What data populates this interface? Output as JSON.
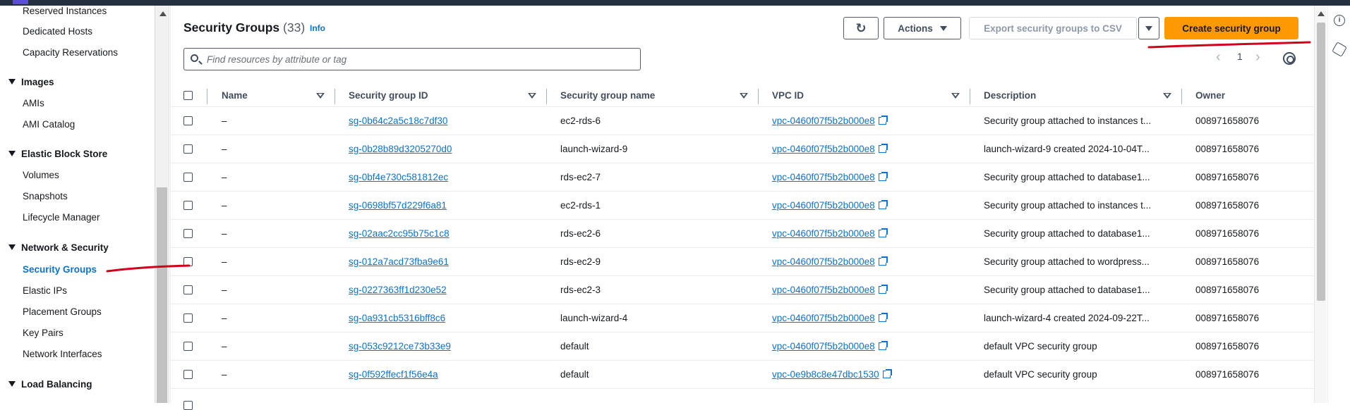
{
  "sidebar": {
    "items_top": [
      {
        "label": "Reserved Instances"
      },
      {
        "label": "Dedicated Hosts"
      },
      {
        "label": "Capacity Reservations"
      }
    ],
    "sections": [
      {
        "title": "Images",
        "items": [
          "AMIs",
          "AMI Catalog"
        ]
      },
      {
        "title": "Elastic Block Store",
        "items": [
          "Volumes",
          "Snapshots",
          "Lifecycle Manager"
        ]
      },
      {
        "title": "Network & Security",
        "items": [
          "Security Groups",
          "Elastic IPs",
          "Placement Groups",
          "Key Pairs",
          "Network Interfaces"
        ]
      },
      {
        "title": "Load Balancing",
        "items": []
      }
    ],
    "active_item": "Security Groups"
  },
  "header": {
    "title": "Security Groups",
    "count": "(33)",
    "info": "Info"
  },
  "toolbar": {
    "refresh_icon": "refresh-icon",
    "actions_label": "Actions",
    "export_label": "Export security groups to CSV",
    "create_label": "Create security group"
  },
  "search": {
    "placeholder": "Find resources by attribute or tag"
  },
  "pagination": {
    "current_page": "1"
  },
  "table": {
    "columns": [
      "Name",
      "Security group ID",
      "Security group name",
      "VPC ID",
      "Description",
      "Owner"
    ],
    "rows": [
      {
        "name": "–",
        "sg_id": "sg-0b64c2a5c18c7df30",
        "sg_name": "ec2-rds-6",
        "vpc": "vpc-0460f07f5b2b000e8",
        "desc": "Security group attached to instances t...",
        "owner": "008971658076"
      },
      {
        "name": "–",
        "sg_id": "sg-0b28b89d3205270d0",
        "sg_name": "launch-wizard-9",
        "vpc": "vpc-0460f07f5b2b000e8",
        "desc": "launch-wizard-9 created 2024-10-04T...",
        "owner": "008971658076"
      },
      {
        "name": "–",
        "sg_id": "sg-0bf4e730c581812ec",
        "sg_name": "rds-ec2-7",
        "vpc": "vpc-0460f07f5b2b000e8",
        "desc": "Security group attached to database1...",
        "owner": "008971658076"
      },
      {
        "name": "–",
        "sg_id": "sg-0698bf57d229f6a81",
        "sg_name": "ec2-rds-1",
        "vpc": "vpc-0460f07f5b2b000e8",
        "desc": "Security group attached to instances t...",
        "owner": "008971658076"
      },
      {
        "name": "–",
        "sg_id": "sg-02aac2cc95b75c1c8",
        "sg_name": "rds-ec2-6",
        "vpc": "vpc-0460f07f5b2b000e8",
        "desc": "Security group attached to database1...",
        "owner": "008971658076"
      },
      {
        "name": "–",
        "sg_id": "sg-012a7acd73fba9e61",
        "sg_name": "rds-ec2-9",
        "vpc": "vpc-0460f07f5b2b000e8",
        "desc": "Security group attached to wordpress...",
        "owner": "008971658076"
      },
      {
        "name": "–",
        "sg_id": "sg-0227363ff1d230e52",
        "sg_name": "rds-ec2-3",
        "vpc": "vpc-0460f07f5b2b000e8",
        "desc": "Security group attached to database1...",
        "owner": "008971658076"
      },
      {
        "name": "–",
        "sg_id": "sg-0a931cb5316bff8c6",
        "sg_name": "launch-wizard-4",
        "vpc": "vpc-0460f07f5b2b000e8",
        "desc": "launch-wizard-4 created 2024-09-22T...",
        "owner": "008971658076"
      },
      {
        "name": "–",
        "sg_id": "sg-053c9212ce73b33e9",
        "sg_name": "default",
        "vpc": "vpc-0460f07f5b2b000e8",
        "desc": "default VPC security group",
        "owner": "008971658076"
      },
      {
        "name": "–",
        "sg_id": "sg-0f592ffecf1f56e4a",
        "sg_name": "default",
        "vpc": "vpc-0e9b8c8e47dbc1530",
        "desc": "default VPC security group",
        "owner": "008971658076"
      }
    ]
  },
  "rail": {
    "icons": [
      "info-icon",
      "settings-hex-icon"
    ]
  },
  "colors": {
    "accent": "#0972d3",
    "primary_button": "#ff9900",
    "annotation": "#d0021b"
  }
}
